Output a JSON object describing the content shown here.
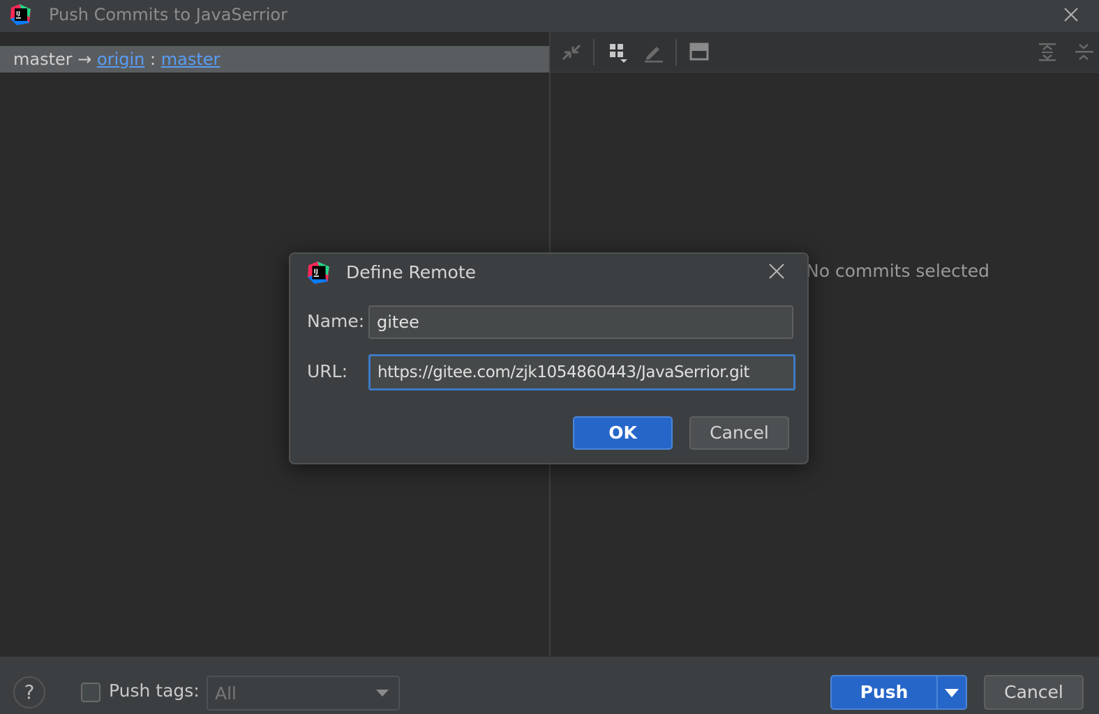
{
  "window": {
    "title": "Push Commits to JavaSerrior"
  },
  "branch_row": {
    "local": "master",
    "arrow": "→",
    "remote": "origin",
    "sep": ":",
    "remote_branch": "master"
  },
  "right_pane": {
    "empty_text": "No commits selected"
  },
  "bottom": {
    "help_label": "?",
    "push_tags_label": "Push tags:",
    "push_tags_checked": false,
    "tags_select_value": "All",
    "push_label": "Push",
    "cancel_label": "Cancel"
  },
  "dialog": {
    "title": "Define Remote",
    "name_label": "Name:",
    "name_value": "gitee",
    "url_label": "URL:",
    "url_value": "https://gitee.com/zjk1054860443/JavaSerrior.git",
    "ok_label": "OK",
    "cancel_label": "Cancel"
  },
  "colors": {
    "accent": "#2766c9",
    "link": "#589df6",
    "background": "#2b2b2b",
    "panel": "#3c3f41"
  }
}
